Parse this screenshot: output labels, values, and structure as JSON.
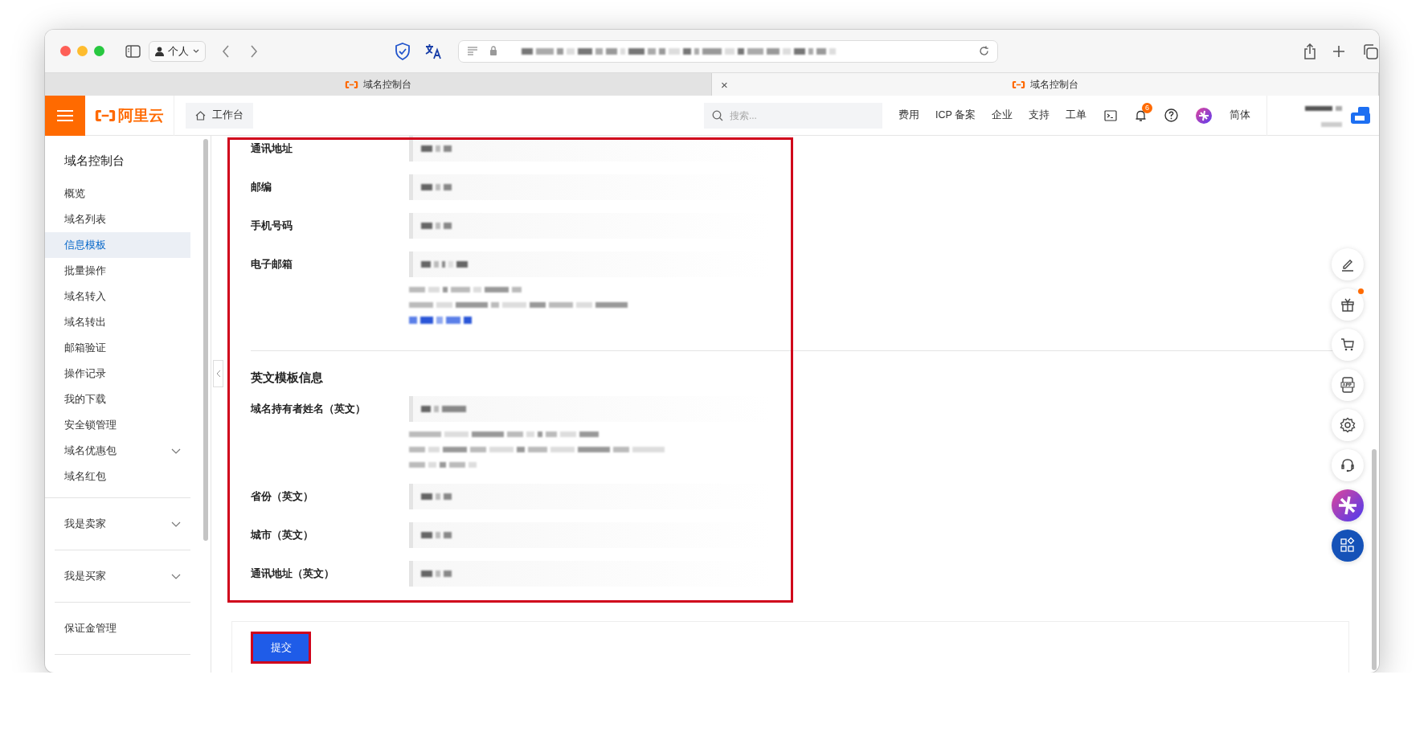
{
  "browser": {
    "profile": "个人",
    "tabs": [
      {
        "title": "域名控制台",
        "selected": false
      },
      {
        "title": "域名控制台",
        "selected": true,
        "close": "×"
      }
    ]
  },
  "header": {
    "logo": "阿里云",
    "workbench": "工作台",
    "search": {
      "placeholder": "搜索..."
    },
    "nav": [
      "费用",
      "ICP 备案",
      "企业",
      "支持",
      "工单"
    ],
    "notification_count": "6",
    "language": "简体"
  },
  "sidebar": {
    "title": "域名控制台",
    "sections": [
      {
        "items": [
          {
            "label": "概览",
            "kind": "link",
            "selected": false
          },
          {
            "label": "域名列表",
            "kind": "link",
            "selected": false
          },
          {
            "label": "信息模板",
            "kind": "link",
            "selected": true
          },
          {
            "label": "批量操作",
            "kind": "link",
            "selected": false
          },
          {
            "label": "域名转入",
            "kind": "link",
            "selected": false
          },
          {
            "label": "域名转出",
            "kind": "link",
            "selected": false
          },
          {
            "label": "邮箱验证",
            "kind": "link",
            "selected": false
          },
          {
            "label": "操作记录",
            "kind": "link",
            "selected": false
          },
          {
            "label": "我的下载",
            "kind": "link",
            "selected": false
          },
          {
            "label": "安全锁管理",
            "kind": "link",
            "selected": false
          },
          {
            "label": "域名优惠包",
            "kind": "group",
            "expanded": false,
            "selected": false
          },
          {
            "label": "域名红包",
            "kind": "link",
            "selected": false
          }
        ]
      },
      {
        "items": [
          {
            "label": "我是卖家",
            "kind": "group",
            "expanded": false,
            "selected": false
          }
        ]
      },
      {
        "items": [
          {
            "label": "我是买家",
            "kind": "group",
            "expanded": false,
            "selected": false
          }
        ]
      },
      {
        "items": [
          {
            "label": "保证金管理",
            "kind": "link",
            "selected": false
          }
        ]
      }
    ]
  },
  "form": {
    "rows": [
      {
        "kind": "field",
        "label": "通讯地址"
      },
      {
        "kind": "field",
        "label": "邮编"
      },
      {
        "kind": "field",
        "label": "手机号码"
      },
      {
        "kind": "field-link",
        "label": "电子邮箱"
      },
      {
        "kind": "section",
        "label": "英文模板信息"
      },
      {
        "kind": "field-help",
        "label": "域名持有者姓名（英文）"
      },
      {
        "kind": "field",
        "label": "省份（英文）"
      },
      {
        "kind": "field",
        "label": "城市（英文）"
      },
      {
        "kind": "field",
        "label": "通讯地址（英文）"
      }
    ],
    "submit": "提交"
  }
}
